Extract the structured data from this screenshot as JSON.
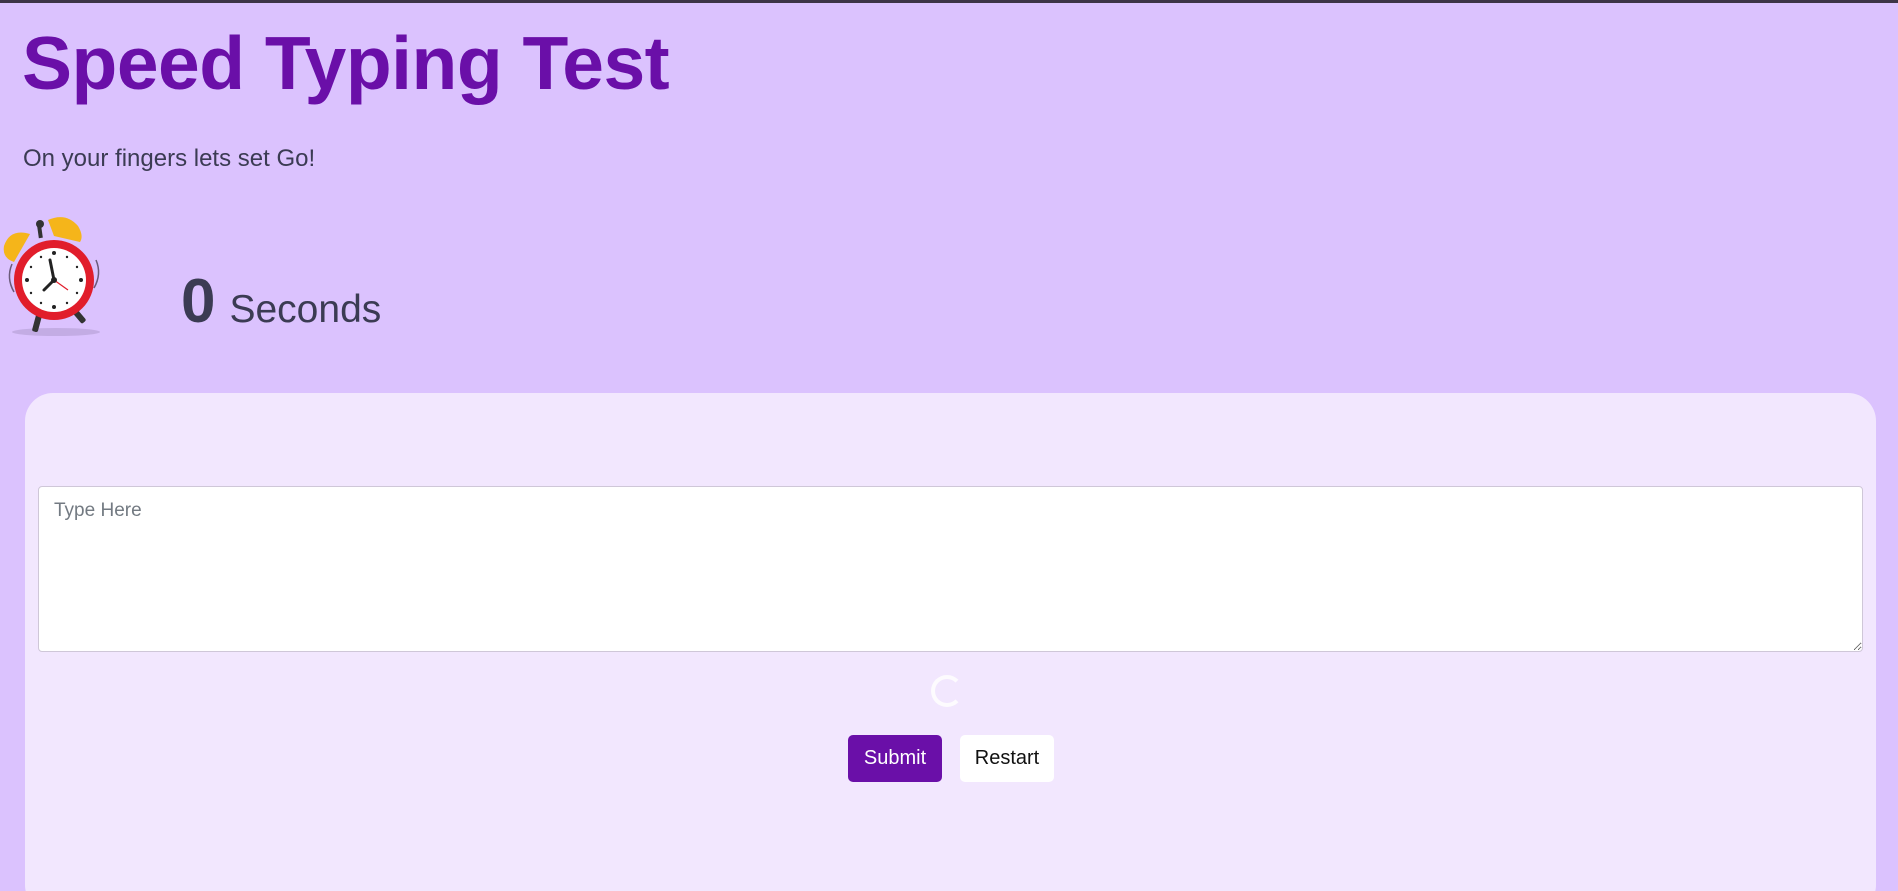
{
  "header": {
    "title": "Speed Typing Test",
    "subtitle": "On your fingers lets set Go!"
  },
  "timer": {
    "icon": "alarm-clock-icon",
    "value": "0",
    "unit": "Seconds"
  },
  "quote": {
    "text": "",
    "loading": true
  },
  "input": {
    "value": "",
    "placeholder": "Type Here"
  },
  "buttons": {
    "submit_label": "Submit",
    "restart_label": "Restart"
  },
  "colors": {
    "background": "#dbc2fe",
    "card": "#f2e7fe",
    "accent": "#6a0fa8",
    "text": "#3b3b53"
  }
}
